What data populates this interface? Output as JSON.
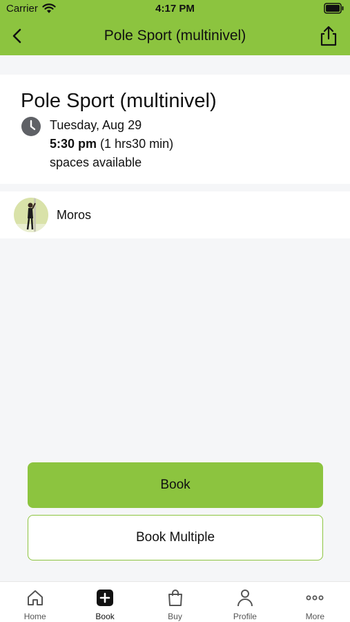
{
  "status_bar": {
    "carrier": "Carrier",
    "time": "4:17 PM"
  },
  "header": {
    "title": "Pole Sport (multinivel)"
  },
  "class": {
    "title": "Pole Sport (multinivel)",
    "date": "Tuesday, Aug 29",
    "time": "5:30 pm",
    "duration": "(1 hrs30 min)",
    "availability": "spaces available"
  },
  "instructor": {
    "name": "Moros"
  },
  "actions": {
    "book_label": "Book",
    "book_multiple_label": "Book Multiple"
  },
  "tabs": [
    {
      "label": "Home",
      "icon": "home-icon"
    },
    {
      "label": "Book",
      "icon": "plus-square-icon"
    },
    {
      "label": "Buy",
      "icon": "shopping-bag-icon"
    },
    {
      "label": "Profile",
      "icon": "person-icon"
    },
    {
      "label": "More",
      "icon": "more-dots-icon"
    }
  ],
  "colors": {
    "accent": "#8cc43f",
    "background": "#f5f6f8"
  }
}
